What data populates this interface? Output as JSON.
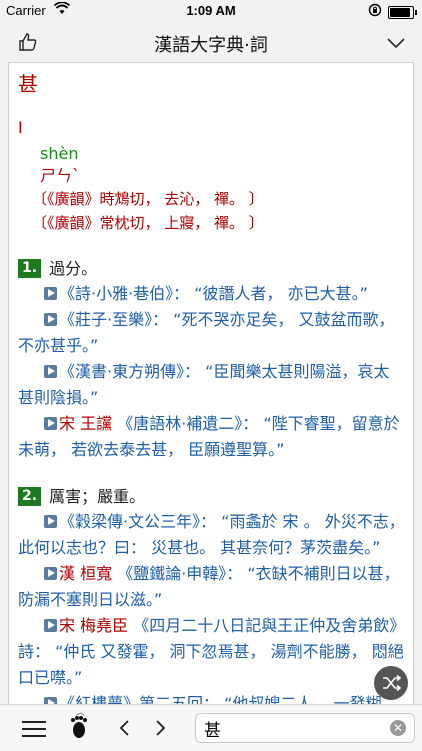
{
  "status": {
    "carrier": "Carrier",
    "time": "1:09 AM"
  },
  "navbar": {
    "title": "漢語大字典·詞"
  },
  "entry": {
    "head": "甚",
    "roman": "I",
    "pinyin": "shèn",
    "zhuyin": "ㄕㄣˋ",
    "rhymes": [
      "〔《廣韻》時鴆切， 去沁， 禪。 〕",
      "〔《廣韻》常枕切， 上寢， 禪。 〕"
    ]
  },
  "senses": [
    {
      "num": "1.",
      "def": "過分。",
      "quotes": [
        {
          "author": "",
          "text": "《詩·小雅·巷伯》： “彼譖人者， 亦已大甚。”"
        },
        {
          "author": "",
          "text": "《莊子·至樂》： “死不哭亦足矣， 又鼓盆而歌， 不亦甚乎。”"
        },
        {
          "author": "",
          "text": "《漢書·東方朔傳》： “臣聞樂太甚則陽溢，哀太甚則陰損。”"
        },
        {
          "author": "宋 王讜",
          "text": "《唐語林·補遺二》： “陛下睿聖，留意於未萌， 若欲去泰去甚， 臣願遵聖算。”"
        }
      ]
    },
    {
      "num": "2.",
      "def": "厲害；嚴重。",
      "quotes": [
        {
          "author": "",
          "text": "《穀梁傳·文公三年》： “雨螽於 宋 。 外災不志， 此何以志也？曰： 災甚也。 其甚奈何？茅茨盡矣。”"
        },
        {
          "author": "漢 桓寬",
          "text": "《鹽鐵論·申韓》： “衣缺不補則日以甚， 防漏不塞則日以滋。”"
        },
        {
          "author": "宋 梅堯臣",
          "text": "《四月二十八日記與王正仲及舍弟飲》詩： “仲氏 又發霍， 洞下忽焉甚， 湯劑不能勝， 悶絕口已噤。”"
        },
        {
          "author": "",
          "text": "《紅樓夢》第二五回： “他叔嫂二人， 一發糊"
        }
      ]
    }
  ],
  "search": {
    "value": "甚"
  }
}
